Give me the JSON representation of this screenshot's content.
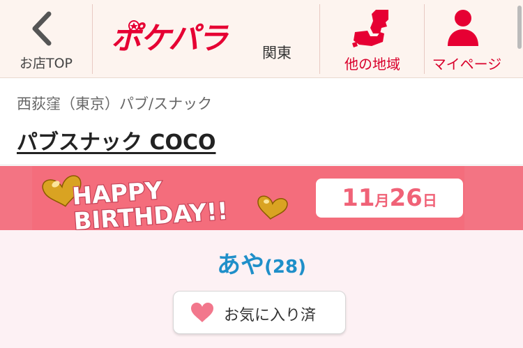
{
  "header": {
    "back_label": "お店TOP",
    "logo_text": "ポケパラ",
    "region": "関東",
    "other_regions_label": "他の地域",
    "mypage_label": "マイページ"
  },
  "shop": {
    "category": "西荻窪（東京）パブ/スナック",
    "name": "パブスナック COCO"
  },
  "birthday": {
    "banner_text_line1": "HAPPY",
    "banner_text_line2": "BIRTHDAY!!",
    "month": "11",
    "month_unit": "月",
    "day": "26",
    "day_unit": "日"
  },
  "cast": {
    "name": "あや",
    "age": "(28)"
  },
  "favorite": {
    "label": "お気に入り済"
  },
  "colors": {
    "brand_red": "#d9002b",
    "banner_pink": "#f37483",
    "cast_blue": "#1f8fc9",
    "heart_pink": "#f2778c"
  },
  "icons": {
    "back": "chevron-left-icon",
    "region": "map-pin-icon",
    "mypage": "person-icon",
    "favorite": "heart-icon"
  }
}
